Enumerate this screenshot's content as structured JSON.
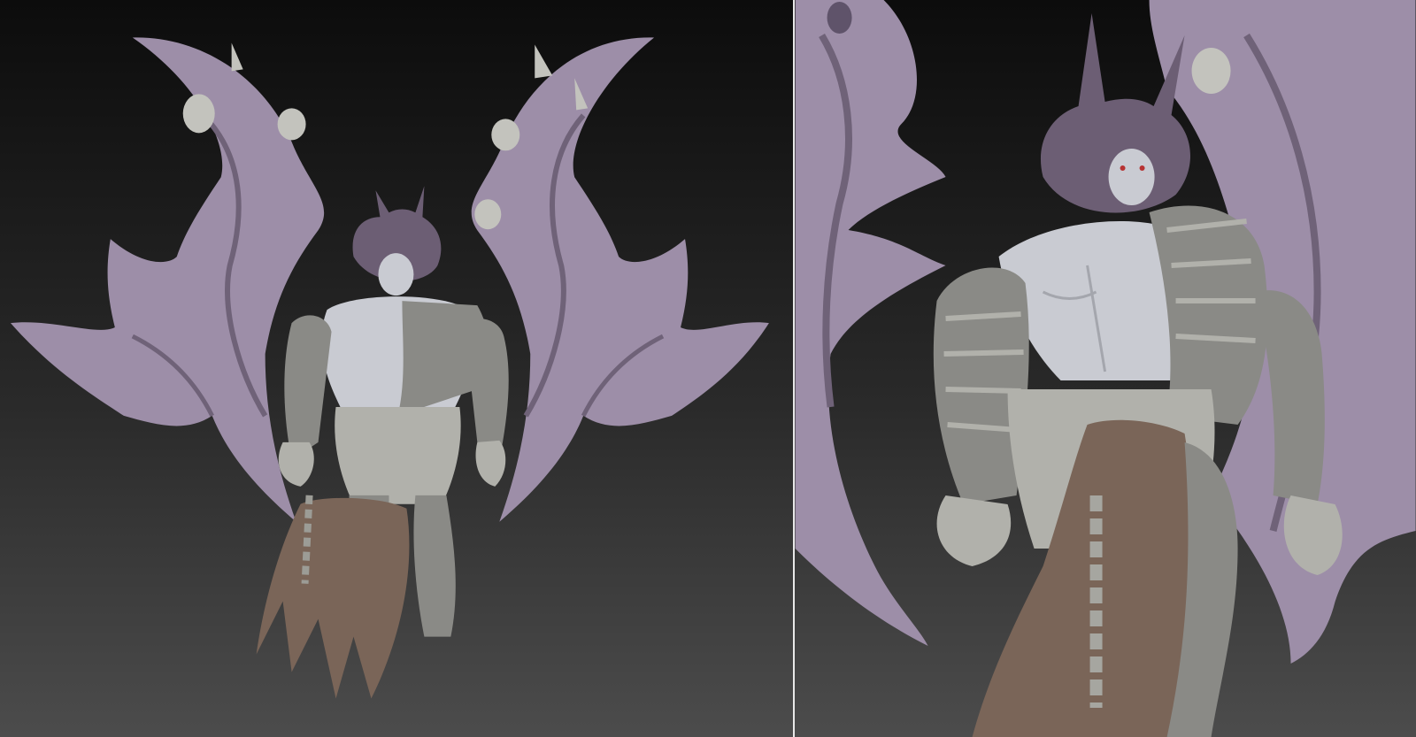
{
  "scene": {
    "kind": "3D sculpt turnaround",
    "views": [
      {
        "name": "full-body-front-view"
      },
      {
        "name": "close-up-three-quarter-view"
      }
    ],
    "colors": {
      "background_top": "#0c0c0c",
      "background_bottom": "#4c4c4c",
      "wing": "#9d8ea8",
      "wing_shadow": "#6f6278",
      "skin": "#c9cbd2",
      "armor": "#8a8a86",
      "armor_light": "#b1b1ab",
      "cloth": "#7a6558",
      "hair": "#6c5e74",
      "divider": "#e8e8e8"
    }
  }
}
